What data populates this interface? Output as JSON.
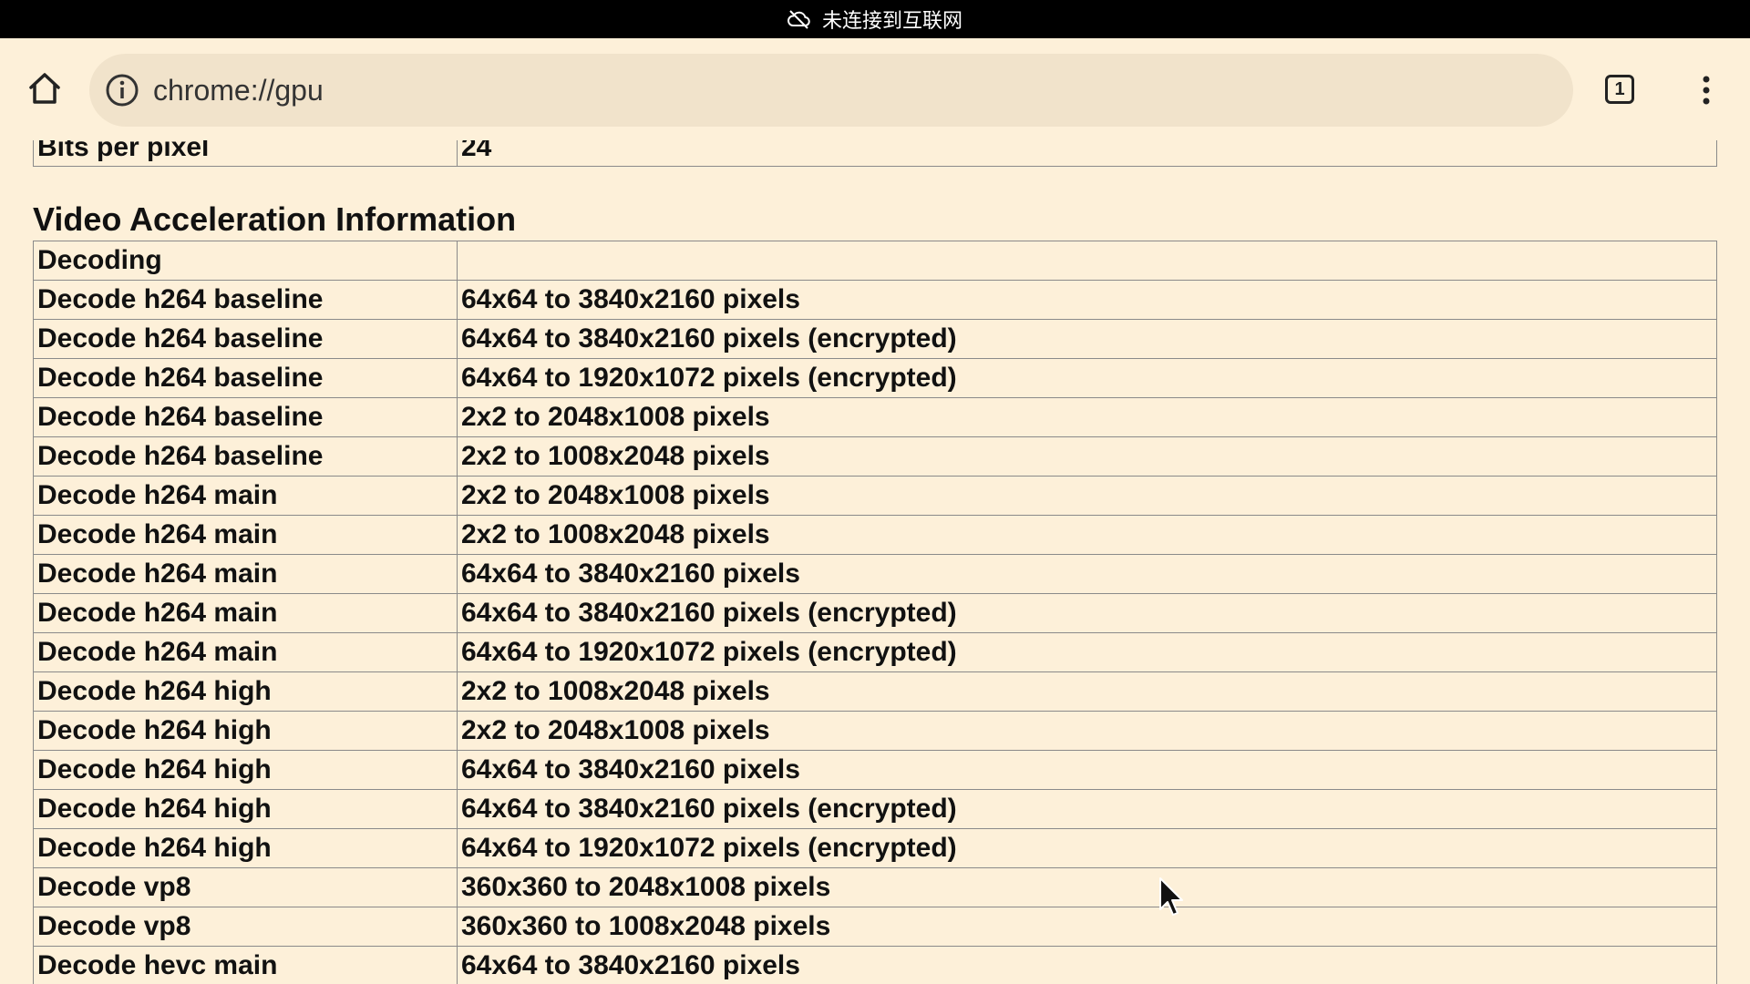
{
  "status_bar": {
    "icon": "cloud-off-icon",
    "text": "未连接到互联网"
  },
  "toolbar": {
    "home_icon": "home-icon",
    "info_icon": "info-icon",
    "url": "chrome://gpu",
    "tab_count": "1",
    "menu_icon": "more-vert-icon"
  },
  "page": {
    "bits_row": {
      "label": "Bits per pixel",
      "value": "24"
    },
    "section_title": "Video Acceleration Information",
    "rows": [
      {
        "label": "Decoding",
        "value": ""
      },
      {
        "label": "Decode h264 baseline",
        "value": "64x64 to 3840x2160 pixels"
      },
      {
        "label": "Decode h264 baseline",
        "value": "64x64 to 3840x2160 pixels (encrypted)"
      },
      {
        "label": "Decode h264 baseline",
        "value": "64x64 to 1920x1072 pixels (encrypted)"
      },
      {
        "label": "Decode h264 baseline",
        "value": "2x2 to 2048x1008 pixels"
      },
      {
        "label": "Decode h264 baseline",
        "value": "2x2 to 1008x2048 pixels"
      },
      {
        "label": "Decode h264 main",
        "value": "2x2 to 2048x1008 pixels"
      },
      {
        "label": "Decode h264 main",
        "value": "2x2 to 1008x2048 pixels"
      },
      {
        "label": "Decode h264 main",
        "value": "64x64 to 3840x2160 pixels"
      },
      {
        "label": "Decode h264 main",
        "value": "64x64 to 3840x2160 pixels (encrypted)"
      },
      {
        "label": "Decode h264 main",
        "value": "64x64 to 1920x1072 pixels (encrypted)"
      },
      {
        "label": "Decode h264 high",
        "value": "2x2 to 1008x2048 pixels"
      },
      {
        "label": "Decode h264 high",
        "value": "2x2 to 2048x1008 pixels"
      },
      {
        "label": "Decode h264 high",
        "value": "64x64 to 3840x2160 pixels"
      },
      {
        "label": "Decode h264 high",
        "value": "64x64 to 3840x2160 pixels (encrypted)"
      },
      {
        "label": "Decode h264 high",
        "value": "64x64 to 1920x1072 pixels (encrypted)"
      },
      {
        "label": "Decode vp8",
        "value": "360x360 to 2048x1008 pixels"
      },
      {
        "label": "Decode vp8",
        "value": "360x360 to 1008x2048 pixels"
      },
      {
        "label": "Decode hevc main",
        "value": "64x64 to 3840x2160 pixels"
      }
    ]
  },
  "colors": {
    "page_background": "#fdf0d9",
    "omnibox_background": "#f1e3cb",
    "status_bar_background": "#000000",
    "table_border": "#8a8a8a"
  }
}
